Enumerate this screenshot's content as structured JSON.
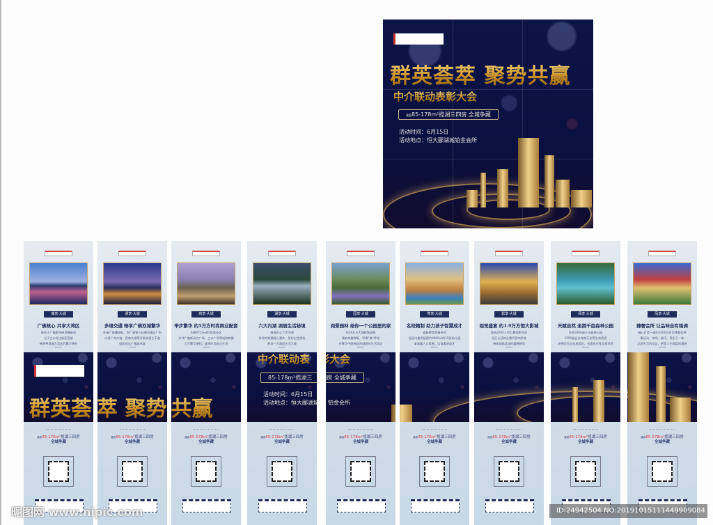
{
  "poster": {
    "title": "群英荟萃 聚势共赢",
    "subtitle": "中介联动表彰大会",
    "banner_prefix": "建面",
    "banner": "85-178m²揽湖三四房 全城争藏",
    "time": "活动时间：6月15日",
    "place": "活动地点：恒大郦湖城铂金会所"
  },
  "band": {
    "title_parts": [
      "群英荟",
      "萃 聚势",
      "共赢"
    ],
    "subtitle_parts": [
      "中介联动表",
      "彰大会"
    ],
    "banner_parts": [
      "85-178m²揽湖三",
      "四房 全城争藏"
    ],
    "time": "活动时间：6月15日",
    "place_parts": [
      "活动地点：恒大郦湖城",
      "铂金会所"
    ]
  },
  "footer": {
    "line1_prefix": "建面",
    "line1_num": "85-178m²",
    "line1_rest": "揽湖三四房",
    "line2": "全城争藏"
  },
  "panels": [
    {
      "tag": "瑞享·大城",
      "heading": "广佛核心 共享大湾区",
      "body": [
        "依托于广佛都市经济圈板块",
        "位于三水北江新区西部",
        "畅享粤港澳大湾区的繁华便利"
      ]
    },
    {
      "tag": "通享·大城",
      "heading": "多维交通 畅享广佛双城繁华",
      "body": [
        "外接广佛肇城轨、南广高铁三站便可通达广州",
        "内接广海大道、西南大道等多条交通主干道",
        "轻松抵达广佛城市群"
      ]
    },
    {
      "tag": "商享·大城",
      "heading": "举步繁华 约5万方时尚商业配套",
      "body": [
        "内拥约5万㎡时尚商业区",
        "外邻广佛新动力广场、三水广场等成熟商圈",
        "汇尽繁华便利，盛享时尚前沿生活"
      ]
    },
    {
      "tag": "湖享·大城",
      "heading": "六大内湖 湖居生活秘境",
      "body": [
        "独具匠心六大内湖",
        "秀秀的湖景随心漫步，揽却尘世烦扰",
        "营造一方湖居生活大境"
      ]
    },
    {
      "tag": "园享·大城",
      "heading": "阅景园林 给你一个公园里的家",
      "body": [
        "约28万方大城欧陆园林",
        "涌纳海量鲜氧，尽情“森”呼吸",
        "在繁华中既拥自然绿意的生活风尚"
      ]
    },
    {
      "tag": "育享·大城",
      "heading": "名校籍制 助力孩子智慧成才",
      "body": [
        "省级教育资源环伺",
        "社区内重资配建约4800㎡的10班幼儿园",
        "拿滋擢人文氛围，培育素质英才"
      ]
    },
    {
      "tag": "影享·大城",
      "heading": "视觉盛宴 约1.9万方恒大影城",
      "body": [
        "容纳2000人的巨幕观影空间",
        "社区认证的全景声音响系统",
        "带来如临其境的震撼感受"
      ]
    },
    {
      "tag": "阅享·大城",
      "heading": "天赋自然 坐拥千亩森林公园",
      "body": [
        "外揽3366亩三水森林公园",
        "2500亩云东海湖万夫等生态资源",
        "环拥尼克文化旅游区、长鹿农庄等文旅项目"
      ]
    },
    {
      "tag": "品享·大城",
      "heading": "臻奢会所 让品味自有格调",
      "body": [
        "精心打造一座约2600方时尚博奢会所",
        "集运动、休闲、娱乐、养生于一体",
        "品质生活的见证，更是人生高度的演绎"
      ]
    }
  ],
  "watermark": {
    "site": "昵图网 www.nipic.com",
    "id": "ID:24942504 NO:20191015111449909084"
  },
  "colors": {
    "navy": "#0d1547",
    "gold": "#e2b445",
    "panel": "#d8e2ec",
    "tag": "#1f2b5a",
    "red": "#e0404a"
  }
}
